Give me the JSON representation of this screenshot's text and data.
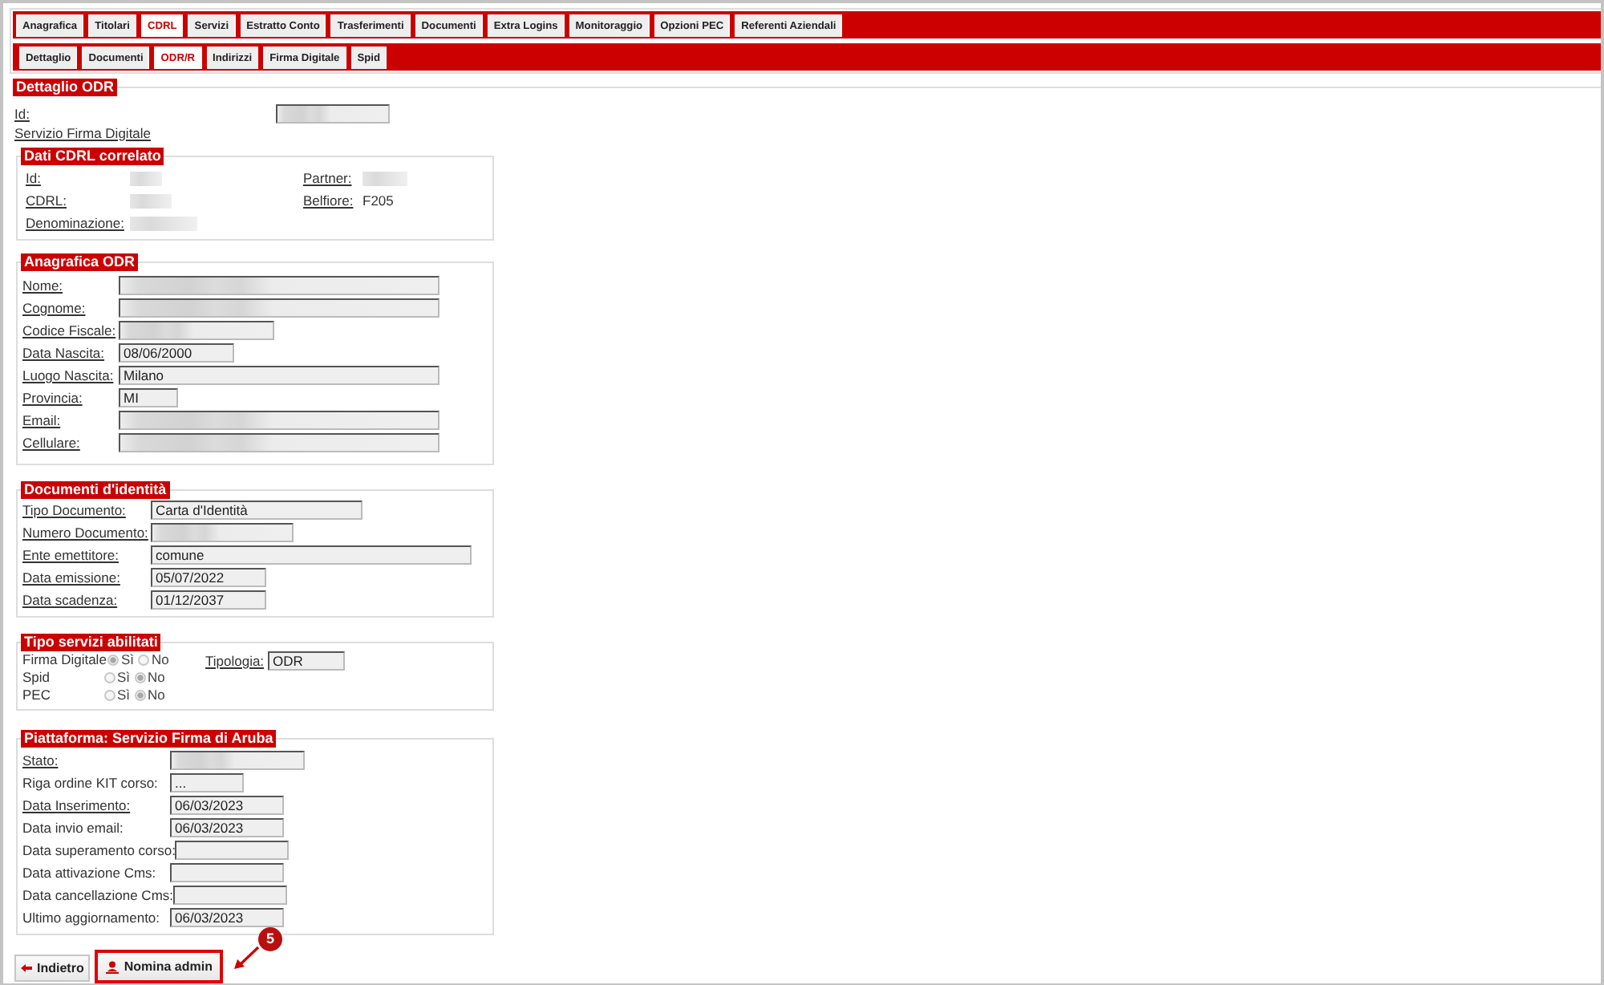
{
  "main_tabs": [
    {
      "label": "Anagrafica",
      "selected": false
    },
    {
      "label": "Titolari",
      "selected": false
    },
    {
      "label": "CDRL",
      "selected": true
    },
    {
      "label": "Servizi",
      "selected": false
    },
    {
      "label": "Estratto Conto",
      "selected": false
    },
    {
      "label": "Trasferimenti",
      "selected": false
    },
    {
      "label": "Documenti",
      "selected": false
    },
    {
      "label": "Extra Logins",
      "selected": false
    },
    {
      "label": "Monitoraggio",
      "selected": false
    },
    {
      "label": "Opzioni PEC",
      "selected": false
    },
    {
      "label": "Referenti Aziendali",
      "selected": false
    }
  ],
  "sub_tabs": [
    {
      "label": "Dettaglio",
      "selected": false
    },
    {
      "label": "Documenti",
      "selected": false
    },
    {
      "label": "ODR/R",
      "selected": true
    },
    {
      "label": "Indirizzi",
      "selected": false
    },
    {
      "label": "Firma Digitale",
      "selected": false
    },
    {
      "label": "Spid",
      "selected": false
    }
  ],
  "detail": {
    "title": "Dettaglio ODR",
    "id": {
      "label": "Id:",
      "underlined": true,
      "redacted": true
    },
    "service": {
      "label": "Servizio Firma Digitale",
      "underlined": true
    }
  },
  "cdrl": {
    "title": "Dati CDRL correlato",
    "left": [
      {
        "label": "Id:",
        "underlined": true,
        "redacted": true
      },
      {
        "label": "CDRL:",
        "underlined": true,
        "redacted": true
      },
      {
        "label": "Denominazione:",
        "underlined": true,
        "redacted": true
      }
    ],
    "right": [
      {
        "label": "Partner:",
        "underlined": true,
        "redacted": true
      },
      {
        "label": "Belfiore:",
        "underlined": true,
        "value": "F205"
      }
    ]
  },
  "anagrafica": {
    "title": "Anagrafica ODR",
    "fields": [
      {
        "label": "Nome:",
        "underlined": true,
        "redacted": true
      },
      {
        "label": "Cognome:",
        "underlined": true,
        "redacted": true
      },
      {
        "label": "Codice Fiscale:",
        "underlined": true,
        "redacted": true
      },
      {
        "label": "Data Nascita:",
        "underlined": true,
        "value": "08/06/2000"
      },
      {
        "label": "Luogo Nascita:",
        "underlined": true,
        "value": "Milano"
      },
      {
        "label": "Provincia:",
        "underlined": true,
        "value": "MI"
      },
      {
        "label": "Email:",
        "underlined": true,
        "redacted": true
      },
      {
        "label": "Cellulare:",
        "underlined": true,
        "redacted": true
      }
    ]
  },
  "documenti": {
    "title": "Documenti d'identità",
    "fields": [
      {
        "label": "Tipo Documento:",
        "underlined": true,
        "value": "Carta d'Identità"
      },
      {
        "label": "Numero Documento:",
        "underlined": true,
        "redacted": true
      },
      {
        "label": "Ente emettitore:",
        "underlined": true,
        "value": "comune"
      },
      {
        "label": "Data emissione:",
        "underlined": true,
        "value": "05/07/2022"
      },
      {
        "label": "Data scadenza:",
        "underlined": true,
        "value": "01/12/2037"
      }
    ]
  },
  "servizi": {
    "title": "Tipo servizi abilitati",
    "services": [
      {
        "label": "Firma Digitale",
        "disabled": true,
        "options": [
          {
            "label": "Sì",
            "selected": true
          },
          {
            "label": "No",
            "selected": false
          }
        ]
      },
      {
        "label": "Spid",
        "disabled": true,
        "options": [
          {
            "label": "Sì",
            "selected": false
          },
          {
            "label": "No",
            "selected": true
          }
        ]
      },
      {
        "label": "PEC",
        "disabled": true,
        "options": [
          {
            "label": "Sì",
            "selected": false
          },
          {
            "label": "No",
            "selected": true
          }
        ]
      }
    ],
    "tipologia": {
      "label": "Tipologia:",
      "underlined": true,
      "value": "ODR"
    }
  },
  "piattaforma": {
    "title": "Piattaforma: Servizio Firma di Aruba",
    "fields": [
      {
        "label": "Stato:",
        "underlined": true,
        "redacted": true
      },
      {
        "label": "Riga ordine KIT corso:",
        "underlined": false,
        "value": "..."
      },
      {
        "label": "Data Inserimento:",
        "underlined": true,
        "value": "06/03/2023"
      },
      {
        "label": "Data invio email:",
        "underlined": false,
        "value": "06/03/2023"
      },
      {
        "label": "Data superamento corso:",
        "underlined": false
      },
      {
        "label": "Data attivazione Cms:",
        "underlined": false
      },
      {
        "label": "Data cancellazione Cms:",
        "underlined": false
      },
      {
        "label": "Ultimo aggiornamento:",
        "underlined": false,
        "value": "06/03/2023"
      }
    ]
  },
  "buttons": [
    {
      "label": "Indietro",
      "kind": "back",
      "highlighted": false
    },
    {
      "label": "Nomina admin",
      "kind": "user",
      "highlighted": true
    }
  ],
  "callout": {
    "number": "5"
  }
}
